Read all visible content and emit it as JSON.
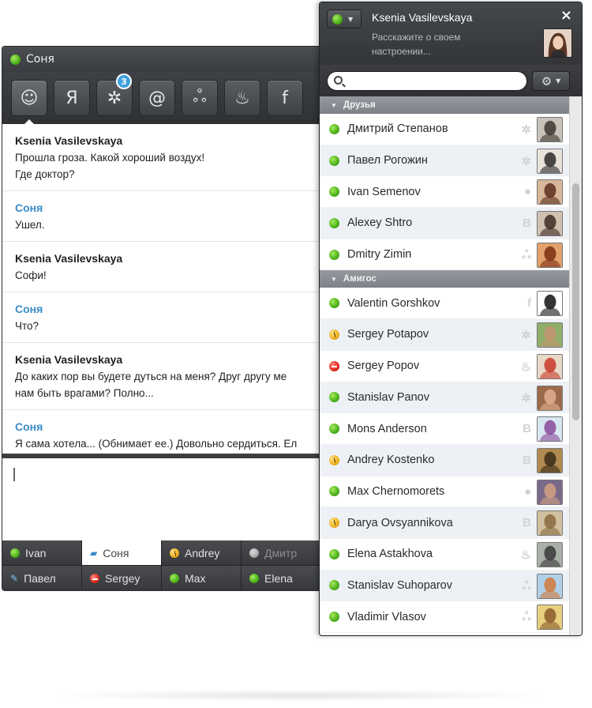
{
  "chat_window": {
    "title": "Соня",
    "services": [
      {
        "name": "smile-icon",
        "glyph": "☺"
      },
      {
        "name": "yandex-icon",
        "glyph": "Я"
      },
      {
        "name": "sparkle-icon",
        "glyph": "✲",
        "badge": "3"
      },
      {
        "name": "at-icon",
        "glyph": "@"
      },
      {
        "name": "agent-icon",
        "glyph": "ஃ"
      },
      {
        "name": "icq-icon",
        "glyph": "♨"
      },
      {
        "name": "facebook-icon",
        "glyph": "f"
      }
    ],
    "messages": [
      {
        "author": "Ksenia Vasilevskaya",
        "self": false,
        "lines": [
          "Прошла гроза. Какой хороший воздух!",
          "Где доктор?"
        ]
      },
      {
        "author": "Соня",
        "self": true,
        "lines": [
          "Ушел."
        ]
      },
      {
        "author": "Ksenia Vasilevskaya",
        "self": false,
        "lines": [
          "Софи!"
        ]
      },
      {
        "author": "Соня",
        "self": true,
        "lines": [
          "Что?"
        ]
      },
      {
        "author": "Ksenia Vasilevskaya",
        "self": false,
        "lines": [
          "До каких пор вы будете дуться на меня? Друг другу ме",
          "нам быть врагами? Полно..."
        ]
      },
      {
        "author": "Соня",
        "self": true,
        "lines": [
          "Я сама хотела... (Обнимает ее.) Довольно сердиться. Ел"
        ]
      }
    ],
    "tabs": [
      {
        "label": "Ivan",
        "status": "online"
      },
      {
        "label": "Соня",
        "status": "chat"
      },
      {
        "label": "Andrey",
        "status": "away"
      },
      {
        "label": "Дмитр",
        "status": "offline"
      },
      {
        "label": "Павел",
        "status": "typing"
      },
      {
        "label": "Sergey",
        "status": "busy"
      },
      {
        "label": "Max",
        "status": "online"
      },
      {
        "label": "Elena",
        "status": "online"
      }
    ]
  },
  "contact_list": {
    "user_name": "Ksenia Vasilevskaya",
    "user_status_text": "Расскажите о своем настроении...",
    "close_label": "×",
    "search_placeholder": "",
    "groups": [
      {
        "name": "Друзья",
        "contacts": [
          {
            "name": "Дмитрий Степанов",
            "status": "online",
            "service": "✲"
          },
          {
            "name": "Павел Рогожин",
            "status": "online",
            "service": "✲"
          },
          {
            "name": "Ivan Semenov",
            "status": "online",
            "service": "●"
          },
          {
            "name": "Alexey Shtro",
            "status": "online",
            "service": "B"
          },
          {
            "name": "Dmitry Zimin",
            "status": "online",
            "service": "ஃ"
          }
        ]
      },
      {
        "name": "Амигос",
        "contacts": [
          {
            "name": "Valentin Gorshkov",
            "status": "online",
            "service": "f"
          },
          {
            "name": "Sergey Potapov",
            "status": "away",
            "service": "✲"
          },
          {
            "name": "Sergey Popov",
            "status": "busy",
            "service": "♨"
          },
          {
            "name": "Stanislav Panov",
            "status": "online",
            "service": "✲"
          },
          {
            "name": "Mons Anderson",
            "status": "online",
            "service": "B"
          },
          {
            "name": "Andrey Kostenko",
            "status": "away",
            "service": "B"
          },
          {
            "name": "Max Chernomorets",
            "status": "online",
            "service": "●"
          },
          {
            "name": "Darya Ovsyannikova",
            "status": "away",
            "service": "B"
          },
          {
            "name": "Elena Astakhova",
            "status": "online",
            "service": "♨"
          },
          {
            "name": "Stanislav Suhoparov",
            "status": "online",
            "service": "ஃ"
          },
          {
            "name": "Vladimir Vlasov",
            "status": "online",
            "service": "ஃ"
          }
        ]
      }
    ]
  },
  "colors": {
    "accent_blue": "#3a8cc9",
    "online_green": "#4bb01a",
    "away_yellow": "#f0b21c",
    "busy_red": "#e02a1c",
    "dark_chrome": "#333538"
  }
}
